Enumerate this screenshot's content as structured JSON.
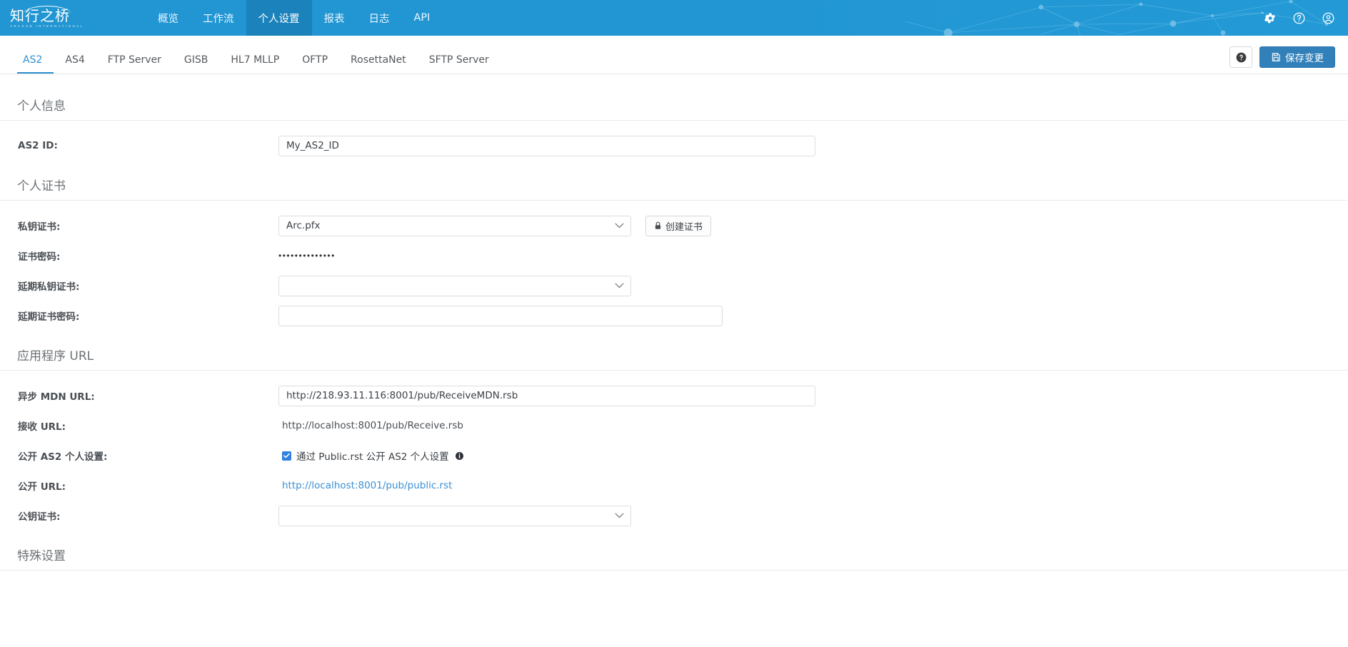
{
  "header": {
    "logo_cn": "知行之桥",
    "logo_en": "ARCESB INTERNATIONAL",
    "nav": [
      {
        "label": "概览",
        "active": false
      },
      {
        "label": "工作流",
        "active": false
      },
      {
        "label": "个人设置",
        "active": true
      },
      {
        "label": "报表",
        "active": false
      },
      {
        "label": "日志",
        "active": false
      },
      {
        "label": "API",
        "active": false
      }
    ],
    "icons": [
      "gear-icon",
      "help-circle-icon",
      "account-circle-icon"
    ],
    "brand_color": "#2196d3",
    "active_nav_color": "#1b82bb"
  },
  "tabbar": {
    "tabs": [
      {
        "label": "AS2",
        "active": true
      },
      {
        "label": "AS4",
        "active": false
      },
      {
        "label": "FTP Server",
        "active": false
      },
      {
        "label": "GISB",
        "active": false
      },
      {
        "label": "HL7 MLLP",
        "active": false
      },
      {
        "label": "OFTP",
        "active": false
      },
      {
        "label": "RosettaNet",
        "active": false
      },
      {
        "label": "SFTP Server",
        "active": false
      }
    ],
    "help_button": "?",
    "save_label": "保存变更",
    "active_color": "#2f8fd0"
  },
  "sections": {
    "personal_info": {
      "title": "个人信息",
      "as2_id_label": "AS2 ID:",
      "as2_id_value": "My_AS2_ID"
    },
    "personal_cert": {
      "title": "个人证书",
      "private_cert_label": "私钥证书:",
      "private_cert_value": "Arc.pfx",
      "create_cert_label": "创建证书",
      "cert_password_label": "证书密码:",
      "cert_password_value": "••••••••••••••",
      "ext_private_cert_label": "延期私钥证书:",
      "ext_private_cert_value": "",
      "ext_cert_password_label": "延期证书密码:",
      "ext_cert_password_value": ""
    },
    "app_url": {
      "title": "应用程序 URL",
      "async_mdn_label": "异步 MDN URL:",
      "async_mdn_value": "http://218.93.11.116:8001/pub/ReceiveMDN.rsb",
      "receive_url_label": "接收 URL:",
      "receive_url_value": "http://localhost:8001/pub/Receive.rsb",
      "public_profile_label": "公开 AS2 个人设置:",
      "public_profile_checkbox_label": "通过 Public.rst 公开 AS2 个人设置",
      "public_profile_checked": true,
      "public_url_label": "公开 URL:",
      "public_url_value": "http://localhost:8001/pub/public.rst",
      "public_cert_label": "公钥证书:",
      "public_cert_value": ""
    },
    "special": {
      "title": "特殊设置"
    }
  }
}
